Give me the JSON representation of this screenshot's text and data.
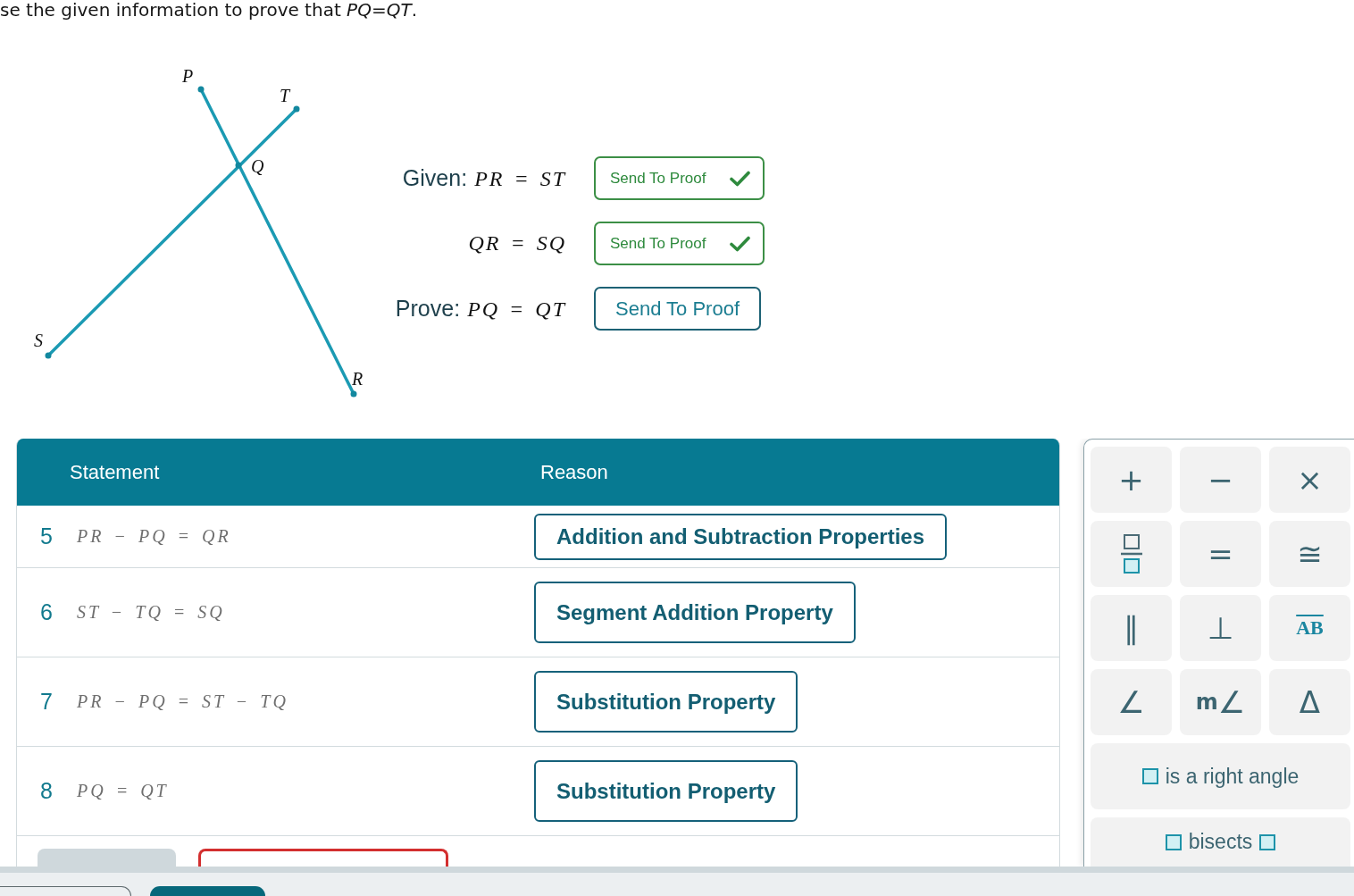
{
  "instruction": "se the given information to prove that *PQ*=*QT*.",
  "diagram": {
    "points": [
      {
        "label": "P"
      },
      {
        "label": "T"
      },
      {
        "label": "Q"
      },
      {
        "label": "S"
      },
      {
        "label": "R"
      }
    ]
  },
  "given": [
    {
      "label": "Given:",
      "statement": "PR = ST",
      "button": "Send To Proof",
      "sent": true
    },
    {
      "statement": "QR = SQ",
      "button": "Send To Proof",
      "sent": true
    },
    {
      "label": "Prove:",
      "statement": "PQ = QT",
      "button": "Send To Proof",
      "sent": false
    }
  ],
  "proof_table": {
    "columns": [
      "Statement",
      "Reason"
    ],
    "rows": [
      {
        "number": "5",
        "statement": "PR − PQ = QR",
        "reason": "Addition and Subtraction Properties"
      },
      {
        "number": "6",
        "statement": "ST − TQ = SQ",
        "reason": "Segment Addition Property"
      },
      {
        "number": "7",
        "statement": "PR − PQ = ST − TQ",
        "reason": "Substitution Property"
      },
      {
        "number": "8",
        "statement": "PQ = QT",
        "reason": "Substitution Property"
      }
    ],
    "new_row": {
      "field_invalid": true
    }
  },
  "keypad": {
    "keys": [
      {
        "kind": "symbol",
        "text": "+"
      },
      {
        "kind": "symbol",
        "text": "−"
      },
      {
        "kind": "symbol",
        "text": "×"
      },
      {
        "kind": "fraction"
      },
      {
        "kind": "symbol",
        "text": "="
      },
      {
        "kind": "symbol",
        "text": "≅"
      },
      {
        "kind": "symbol",
        "text": "∥"
      },
      {
        "kind": "symbol",
        "text": "⊥"
      },
      {
        "kind": "overline",
        "text": "AB"
      },
      {
        "kind": "symbol",
        "text": "∠"
      },
      {
        "kind": "symbol",
        "text": "**m**∠"
      },
      {
        "kind": "symbol",
        "text": "Δ"
      },
      {
        "kind": "template",
        "slot_before": true,
        "text": "is a right angle",
        "slot_after": false
      },
      {
        "kind": "template",
        "slot_before": true,
        "text": "bisects",
        "slot_after": true
      }
    ]
  }
}
